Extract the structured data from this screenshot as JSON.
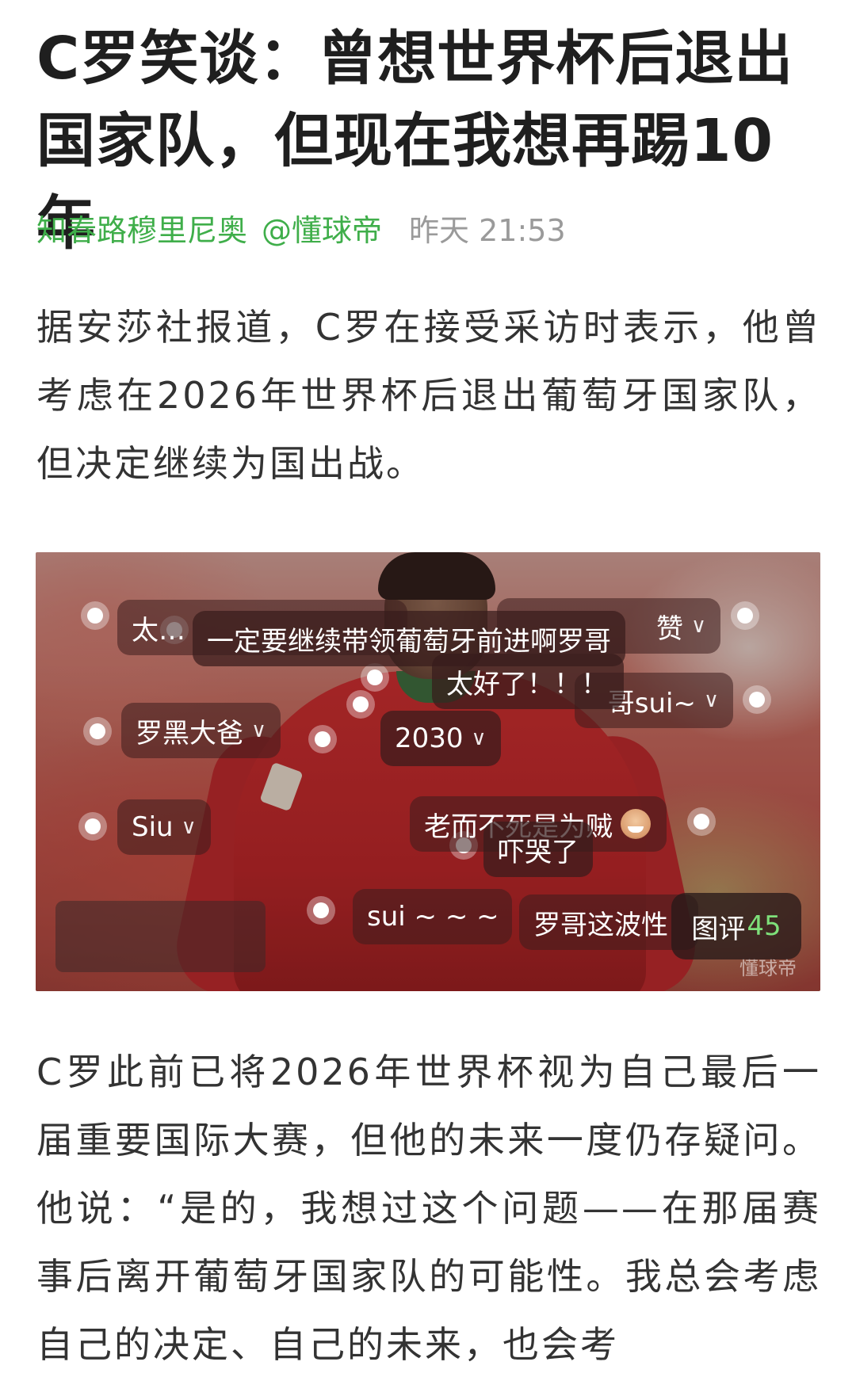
{
  "article": {
    "title": "C罗笑谈：曾想世界杯后退出国家队，但现在我想再踢10年",
    "author": "知春路穆里尼奥",
    "handle": "@懂球帝",
    "time": "昨天 21:53",
    "paragraph1": "据安莎社报道，C罗在接受采访时表示，他曾考虑在2026年世界杯后退出葡萄牙国家队，但决定继续为国出战。",
    "paragraph2": "C罗此前已将2026年世界杯视为自己最后一届重要国际大赛，但他的未来一度仍存疑问。他说：“是的，我想过这个问题——在那届赛事后离开葡萄牙国家队的可能性。我总会考虑自己的决定、自己的未来，也会考"
  },
  "image": {
    "watermark": "懂球帝",
    "comments": [
      {
        "text": "太…",
        "chevron": false
      },
      {
        "text": "赞",
        "chevron": true
      },
      {
        "text": "一定要继续带领葡萄牙前进啊罗哥",
        "chevron": false
      },
      {
        "text": "太好了！！！",
        "chevron": false
      },
      {
        "text": "哥sui~",
        "chevron": true
      },
      {
        "text": "罗黑大爸",
        "chevron": true
      },
      {
        "text": "2030",
        "chevron": true
      },
      {
        "text": "Siu",
        "chevron": true
      },
      {
        "text": "老而不死是为贼",
        "chevron": false
      },
      {
        "text": "吓哭了",
        "chevron": false
      },
      {
        "text": "sui ~ ~ ~",
        "chevron": false
      },
      {
        "text": "罗哥这波性",
        "chevron": false
      }
    ],
    "tupin_label": "图评",
    "tupin_count": "45"
  }
}
